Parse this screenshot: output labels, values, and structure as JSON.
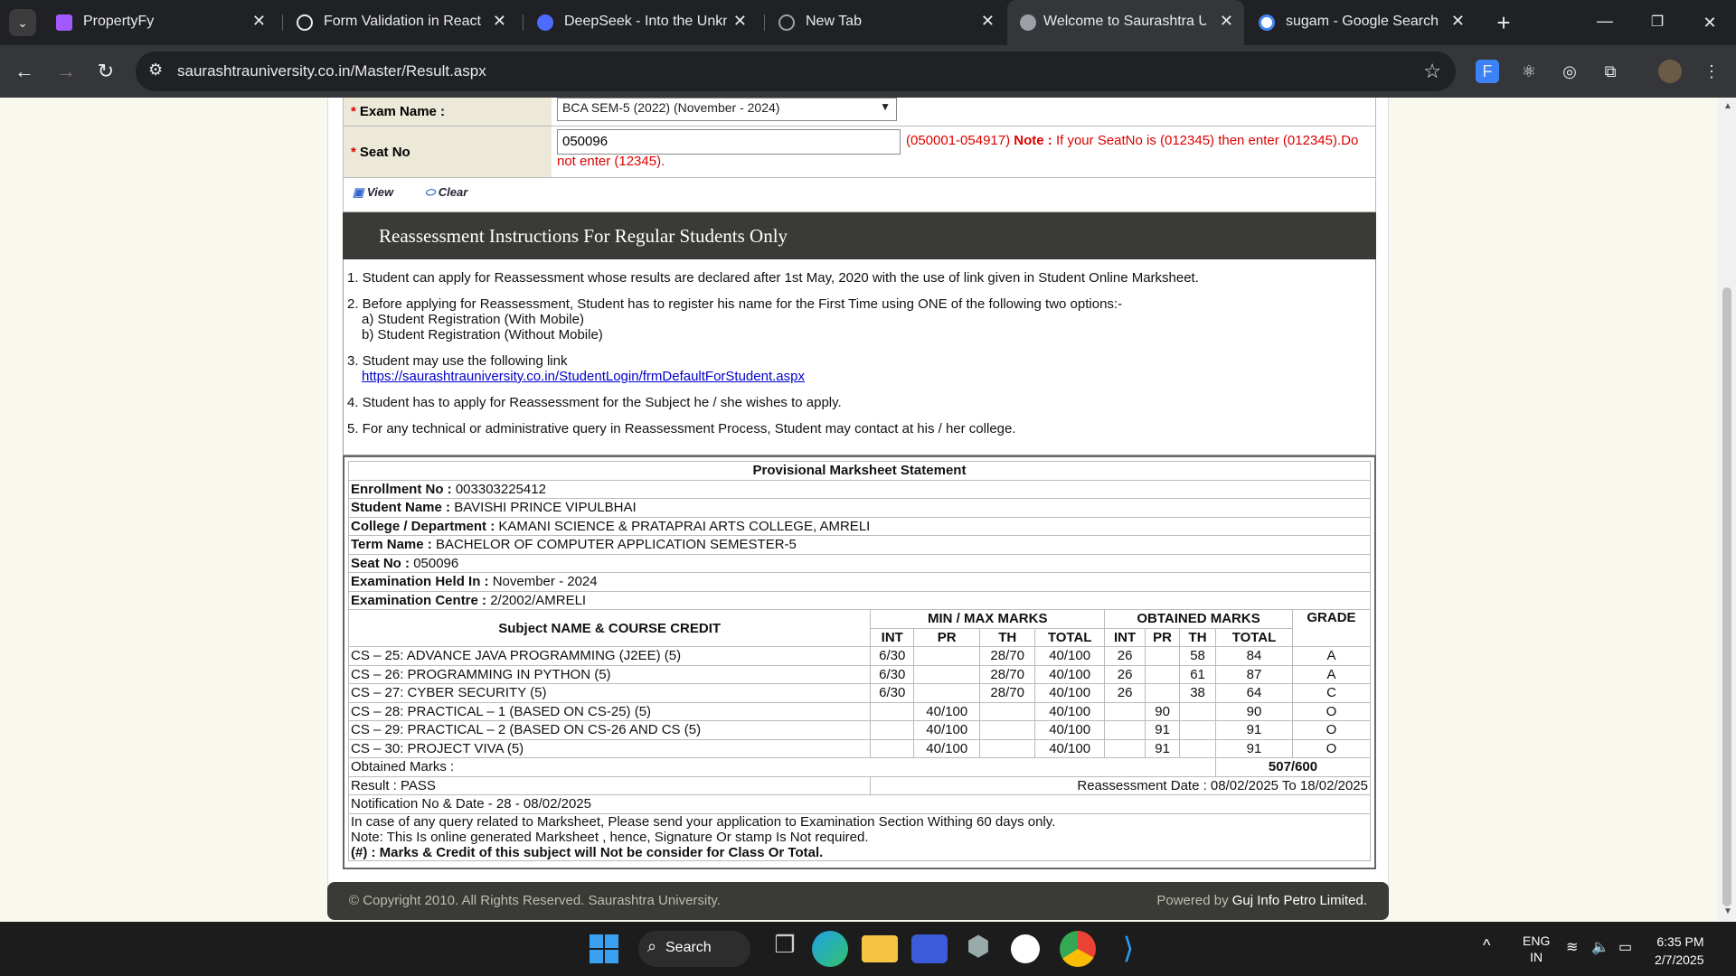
{
  "browser": {
    "tabs": [
      {
        "title": "PropertyFy",
        "color": "#a259ff"
      },
      {
        "title": "Form Validation in React",
        "color": "#9aa0a6"
      },
      {
        "title": "DeepSeek - Into the Unkno",
        "color": "#4d6bfe"
      },
      {
        "title": "New Tab",
        "color": "#9aa0a6"
      },
      {
        "title": "Welcome to Saurashtra Un",
        "color": "#9aa0a6"
      },
      {
        "title": "sugam - Google Search",
        "color": "#4285f4"
      }
    ],
    "url": "saurashtrauniversity.co.in/Master/Result.aspx"
  },
  "form": {
    "exam_label": "Exam Name :",
    "exam_value": "BCA SEM-5 (2022) (November - 2024)",
    "seat_label": "Seat No",
    "seat_value": "050096",
    "seat_range": "(050001-054917)",
    "note_label": "Note :",
    "note_text": "If your SeatNo is (012345) then enter (012345).Do not enter (12345).",
    "view_label": "View",
    "clear_label": "Clear"
  },
  "instructions": {
    "heading": "Reassessment Instructions For Regular Students Only",
    "i1": "1. Student can apply for Reassessment whose results are declared after 1st May, 2020 with the use of link given in Student Online Marksheet.",
    "i2": "2. Before applying for Reassessment, Student has to register his name for the First Time using ONE of the following two options:-",
    "i2a": "a) Student Registration (With Mobile)",
    "i2b": "b) Student Registration (Without Mobile)",
    "i3": "3. Student may use the following link",
    "i3link": "https://saurashtrauniversity.co.in/StudentLogin/frmDefaultForStudent.aspx",
    "i4": "4. Student has to apply for Reassessment for the Subject he / she wishes to apply.",
    "i5": "5. For any technical or administrative query in Reassessment Process, Student may contact at his / her college."
  },
  "marksheet": {
    "title": "Provisional Marksheet Statement",
    "info": [
      {
        "k": "Enrollment No :",
        "v": "003303225412"
      },
      {
        "k": "Student Name :",
        "v": "BAVISHI PRINCE VIPULBHAI"
      },
      {
        "k": "College / Department :",
        "v": "KAMANI SCIENCE & PRATAPRAI ARTS COLLEGE, AMRELI"
      },
      {
        "k": "Term Name :",
        "v": "BACHELOR OF COMPUTER APPLICATION SEMESTER-5"
      },
      {
        "k": "Seat No :",
        "v": "050096"
      },
      {
        "k": "Examination Held In :",
        "v": "November - 2024"
      },
      {
        "k": "Examination Centre :",
        "v": "2/2002/AMRELI"
      }
    ],
    "h_subject": "Subject NAME & COURSE CREDIT",
    "h_minmax": "MIN / MAX MARKS",
    "h_obtained": "OBTAINED MARKS",
    "h_grade": "GRADE",
    "sub": [
      "INT",
      "PR",
      "TH",
      "TOTAL",
      "INT",
      "PR",
      "TH",
      "TOTAL"
    ],
    "rows": [
      [
        "CS – 25: ADVANCE JAVA PROGRAMMING (J2EE) (5)",
        "6/30",
        "",
        "28/70",
        "40/100",
        "26",
        "",
        "58",
        "84",
        "A"
      ],
      [
        "CS – 26: PROGRAMMING IN PYTHON (5)",
        "6/30",
        "",
        "28/70",
        "40/100",
        "26",
        "",
        "61",
        "87",
        "A"
      ],
      [
        "CS – 27: CYBER SECURITY (5)",
        "6/30",
        "",
        "28/70",
        "40/100",
        "26",
        "",
        "38",
        "64",
        "C"
      ],
      [
        "CS – 28: PRACTICAL – 1 (BASED ON CS-25) (5)",
        "",
        "40/100",
        "",
        "40/100",
        "",
        "90",
        "",
        "90",
        "O"
      ],
      [
        "CS – 29: PRACTICAL – 2 (BASED ON CS-26 AND CS (5)",
        "",
        "40/100",
        "",
        "40/100",
        "",
        "91",
        "",
        "91",
        "O"
      ],
      [
        "CS – 30: PROJECT VIVA (5)",
        "",
        "40/100",
        "",
        "40/100",
        "",
        "91",
        "",
        "91",
        "O"
      ]
    ],
    "obtained_label": "Obtained Marks :",
    "obtained_value": "507/600",
    "result": "Result : PASS",
    "reassess": "Reassessment Date : 08/02/2025 To 18/02/2025",
    "notification": "Notification No & Date - 28 - 08/02/2025",
    "note1": "In case of any query related to Marksheet, Please send your application to Examination Section Withing 60 days only.",
    "note2": "Note: This Is online generated Marksheet , hence, Signature Or stamp Is Not required.",
    "note3": "(#) : Marks & Credit of this subject will Not be consider for Class Or Total."
  },
  "footer": {
    "copyright": "© Copyright 2010. All Rights Reserved. Saurashtra University.",
    "powered": "Powered by",
    "company": "Guj Info Petro Limited."
  },
  "taskbar": {
    "search": "Search",
    "lang1": "ENG",
    "lang2": "IN",
    "time": "6:35 PM",
    "date": "2/7/2025"
  }
}
